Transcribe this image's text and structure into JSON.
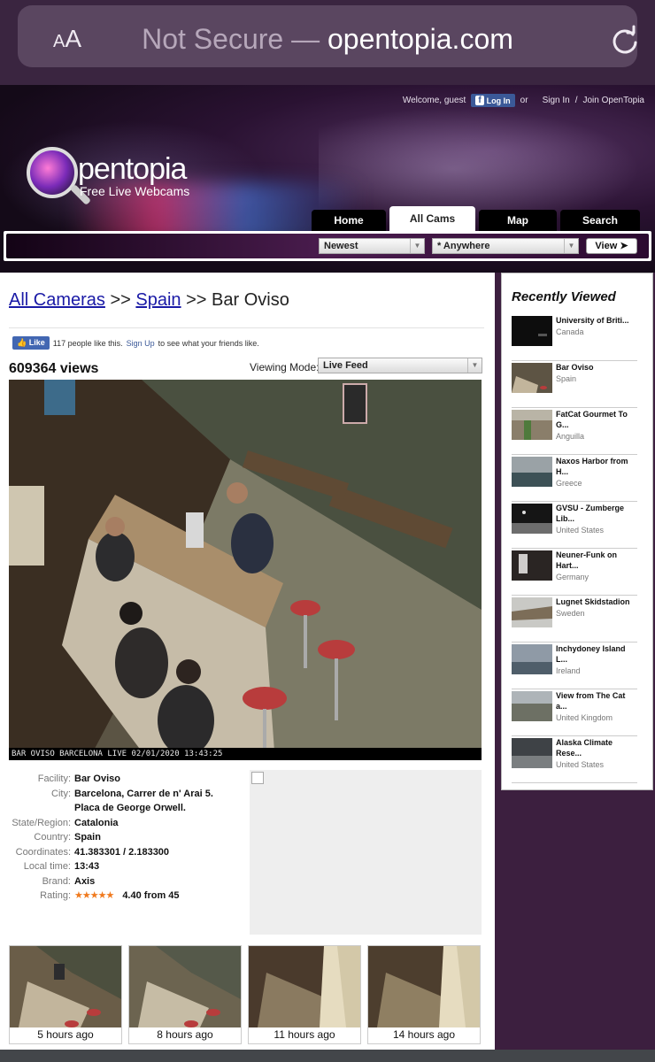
{
  "browser": {
    "text_size_label_small": "A",
    "text_size_label_large": "A",
    "not_secure": "Not Secure",
    "separator": " — ",
    "domain": "opentopia.com"
  },
  "header": {
    "welcome": "Welcome, guest",
    "fb_login": "Log In",
    "or": "or",
    "sign_in": "Sign In",
    "slash": "/",
    "join": "Join OpenTopia",
    "logo_word": "pentopia",
    "logo_tagline": "Free Live Webcams",
    "tabs": [
      {
        "label": "Home",
        "active": false
      },
      {
        "label": "All Cams",
        "active": true
      },
      {
        "label": "Map",
        "active": false
      },
      {
        "label": "Search",
        "active": false
      }
    ],
    "filter_sort": "Newest",
    "filter_location": "* Anywhere",
    "view_button": "View ➤"
  },
  "main": {
    "breadcrumb": {
      "all_cameras": "All Cameras",
      "sep1": " >> ",
      "country": "Spain",
      "sep2": " >> ",
      "current": "Bar Oviso"
    },
    "fb_like": {
      "button": "Like",
      "text_before": "117 people like this.",
      "signup": "Sign Up",
      "text_after": "to see what your friends like."
    },
    "views": "609364 views",
    "viewing_mode_label": "Viewing Mode:",
    "viewing_mode_value": "Live Feed",
    "cam_caption": "BAR OVISO BARCELONA LIVE 02/01/2020 13:43:25",
    "info": {
      "facility_label": "Facility:",
      "facility": "Bar Oviso",
      "city_label": "City:",
      "city": "Barcelona, Carrer de n' Arai 5. Placa de George Orwell.",
      "state_label": "State/Region:",
      "state": "Catalonia",
      "country_label": "Country:",
      "country": "Spain",
      "coords_label": "Coordinates:",
      "coords": "41.383301 / 2.183300",
      "localtime_label": "Local time:",
      "localtime": "13:43",
      "brand_label": "Brand:",
      "brand": "Axis",
      "rating_label": "Rating:",
      "rating_stars": "★★★★★",
      "rating_text": "4.40 from 45",
      "rating_value": 4.4
    },
    "thumbnails": [
      {
        "caption": "5 hours ago"
      },
      {
        "caption": "8 hours ago"
      },
      {
        "caption": "11 hours ago"
      },
      {
        "caption": "14 hours ago"
      }
    ]
  },
  "sidebar": {
    "title": "Recently Viewed",
    "items": [
      {
        "name": "University of Briti...",
        "country": "Canada"
      },
      {
        "name": "Bar Oviso",
        "country": "Spain"
      },
      {
        "name": "FatCat Gourmet To G...",
        "country": "Anguilla"
      },
      {
        "name": "Naxos Harbor from H...",
        "country": "Greece"
      },
      {
        "name": "GVSU - Zumberge Lib...",
        "country": "United States"
      },
      {
        "name": "Neuner-Funk on Hart...",
        "country": "Germany"
      },
      {
        "name": "Lugnet Skidstadion",
        "country": "Sweden"
      },
      {
        "name": "Inchydoney Island L...",
        "country": "Ireland"
      },
      {
        "name": "View from The Cat a...",
        "country": "United Kingdom"
      },
      {
        "name": "Alaska Climate Rese...",
        "country": "United States"
      }
    ]
  },
  "colors": {
    "accent_purple": "#3c1f3f",
    "link_blue": "#1a1aa6",
    "star_orange": "#f07a1e"
  }
}
